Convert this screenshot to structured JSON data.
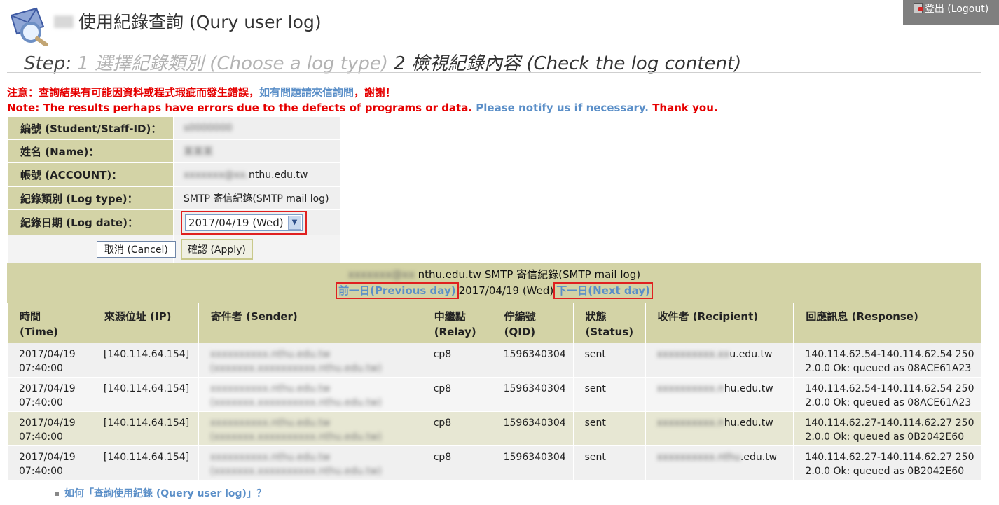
{
  "header": {
    "logout_label": "登出 (Logout)",
    "title": "使用紀錄查詢 (Qury user log)"
  },
  "steps": {
    "label": "Step:",
    "step1": "1 選擇紀錄類別 (Choose a log type)",
    "step2": "2 檢視紀錄內容 (Check the log content)"
  },
  "notes": {
    "zh_red": "注意：查詢結果有可能因資料或程式瑕疵而發生錯誤，",
    "zh_link": "如有問題請來信詢問",
    "zh_end": "，謝謝！",
    "en_red": "Note: The results perhaps have errors due to the defects of programs or data.",
    "en_link": "Please notify us if necessary.",
    "en_end": "Thank you."
  },
  "form": {
    "id_label": "編號 (Student/Staff-ID)：",
    "id_value": "s0000000",
    "name_label": "姓名 (Name)：",
    "name_value": "某某某",
    "account_label": "帳號 (ACCOUNT)：",
    "account_blur": "xxxxxxx@xx.",
    "account_value": "nthu.edu.tw",
    "logtype_label": "紀錄類別 (Log type)：",
    "logtype_value": "SMTP 寄信紀錄(SMTP mail log)",
    "logdate_label": "紀錄日期 (Log date)：",
    "logdate_value": "2017/04/19 (Wed)",
    "cancel_label": "取消 (Cancel)",
    "apply_label": "確認 (Apply)"
  },
  "log": {
    "head_blur": "xxxxxxx@xx",
    "head_title": "nthu.edu.tw SMTP 寄信紀錄(SMTP mail log)",
    "prev_label": "前一日(Previous day)",
    "date": "2017/04/19 (Wed)",
    "next_label": "下一日(Next day)",
    "columns": [
      "時間\n(Time)",
      "來源位址 (IP)",
      "寄件者 (Sender)",
      "中繼點\n(Relay)",
      "佇編號\n(QID)",
      "狀態\n(Status)",
      "收件者 (Recipient)",
      "回應訊息 (Response)"
    ],
    "rows": [
      {
        "date": "2017/04/19",
        "time": "07:40:00",
        "ip": "[140.114.64.154]",
        "sender1": "xxxxxxxxxx.nthu.edu.tw",
        "sender2": "(xxxxxxx.xxxxxxxxxx.nthu.edu.tw)",
        "relay": "cp8",
        "qid": "1596340304",
        "status": "sent",
        "recip_blur": "xxxxxxxxxx.xx",
        "recip": "u.edu.tw",
        "resp1": "140.114.62.54-140.114.62.54 250",
        "resp2": "2.0.0 Ok: queued as 08ACE61A23"
      },
      {
        "date": "2017/04/19",
        "time": "07:40:00",
        "ip": "[140.114.64.154]",
        "sender1": "xxxxxxxxxx.nthu.edu.tw",
        "sender2": "(xxxxxxx.xxxxxxxxxx.nthu.edu.tw)",
        "relay": "cp8",
        "qid": "1596340304",
        "status": "sent",
        "recip_blur": "xxxxxxxxxx.n",
        "recip": "hu.edu.tw",
        "resp1": "140.114.62.54-140.114.62.54 250",
        "resp2": "2.0.0 Ok: queued as 08ACE61A23"
      },
      {
        "date": "2017/04/19",
        "time": "07:40:00",
        "ip": "[140.114.64.154]",
        "sender1": "xxxxxxxxxx.nthu.edu.tw",
        "sender2": "(xxxxxxx.xxxxxxxxxx.nthu.edu.tw)",
        "relay": "cp8",
        "qid": "1596340304",
        "status": "sent",
        "recip_blur": "xxxxxxxxxx.n",
        "recip": "hu.edu.tw",
        "resp1": "140.114.62.27-140.114.62.27 250",
        "resp2": "2.0.0 Ok: queued as 0B2042E60"
      },
      {
        "date": "2017/04/19",
        "time": "07:40:00",
        "ip": "[140.114.64.154]",
        "sender1": "xxxxxxxxxx.nthu.edu.tw",
        "sender2": "(xxxxxxx.xxxxxxxxxx.nthu.edu.tw)",
        "relay": "cp8",
        "qid": "1596340304",
        "status": "sent",
        "recip_blur": "xxxxxxxxxx.nthu",
        "recip": ".edu.tw",
        "resp1": "140.114.62.27-140.114.62.27 250",
        "resp2": "2.0.0 Ok: queued as 0B2042E60"
      }
    ]
  },
  "footer": {
    "help_link": "如何「查詢使用紀錄 (Query user log)」？"
  },
  "colors": {
    "khaki": "#d3d3a6",
    "alert_red": "#e60000",
    "link_blue": "#5b8fc8",
    "highlight_box": "#e02020"
  }
}
